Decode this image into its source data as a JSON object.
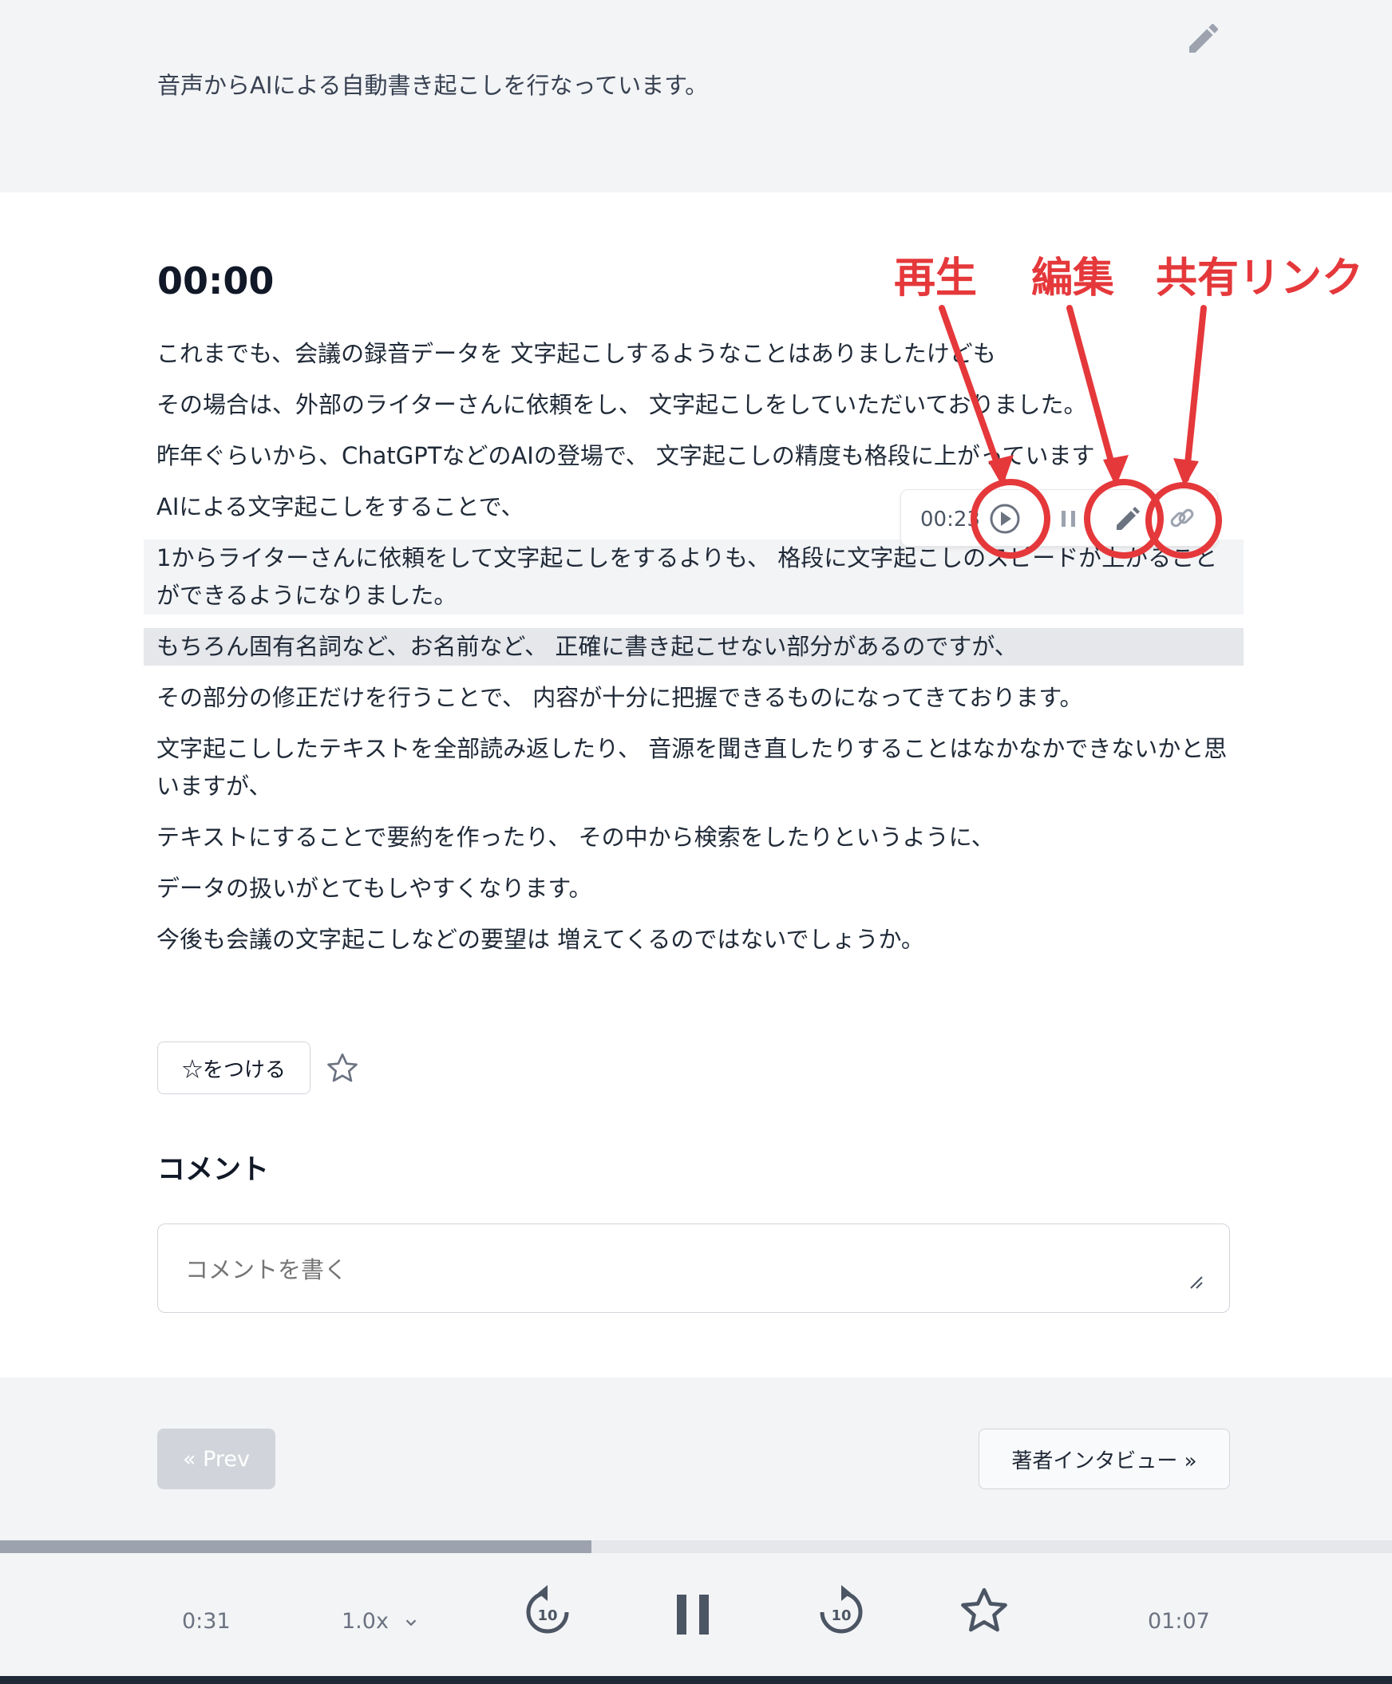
{
  "description": "音声からAIによる自動書き起こしを行なっています。",
  "current_time": "00:00",
  "transcript": [
    "これまでも、会議の録音データを 文字起こしするようなことはありましたけども",
    "その場合は、外部のライターさんに依頼をし、 文字起こしをしていただいておりました。",
    "昨年ぐらいから、ChatGPTなどのAIの登場で、 文字起こしの精度も格段に上がっています",
    "AIによる文字起こしをすることで、",
    "1からライターさんに依頼をして文字起こしをするよりも、 格段に文字起こしのスピードが上がることができるようになりました。",
    "もちろん固有名詞など、お名前など、 正確に書き起こせない部分があるのですが、",
    "その部分の修正だけを行うことで、 内容が十分に把握できるものになってきております。",
    "文字起こししたテキストを全部読み返したり、 音源を聞き直したりすることはなかなかできないかと思いますが、",
    "テキストにすることで要約を作ったり、 その中から検索をしたりというように、",
    "データの扱いがとてもしやすくなります。",
    "今後も会議の文字起こしなどの要望は 増えてくるのではないでしょうか。"
  ],
  "segment_toolbar": {
    "time": "00:23",
    "play_icon": "play-circle-icon",
    "pause_icon": "pause-icon",
    "edit_icon": "pencil-icon",
    "link_icon": "link-icon"
  },
  "annotations": {
    "play": "再生",
    "edit": "編集",
    "share": "共有リンク",
    "color": "#e5383b"
  },
  "star": {
    "button_label": "☆をつける",
    "icon": "star-outline-icon"
  },
  "comments": {
    "title": "コメント",
    "placeholder": "コメントを書く"
  },
  "navigation": {
    "prev_label": "« Prev",
    "next_label": "著者インタビュー »"
  },
  "player": {
    "elapsed": "0:31",
    "speed": "1.0x",
    "duration": "01:07",
    "progress": 0.425,
    "rewind_seconds": "10",
    "forward_seconds": "10"
  }
}
